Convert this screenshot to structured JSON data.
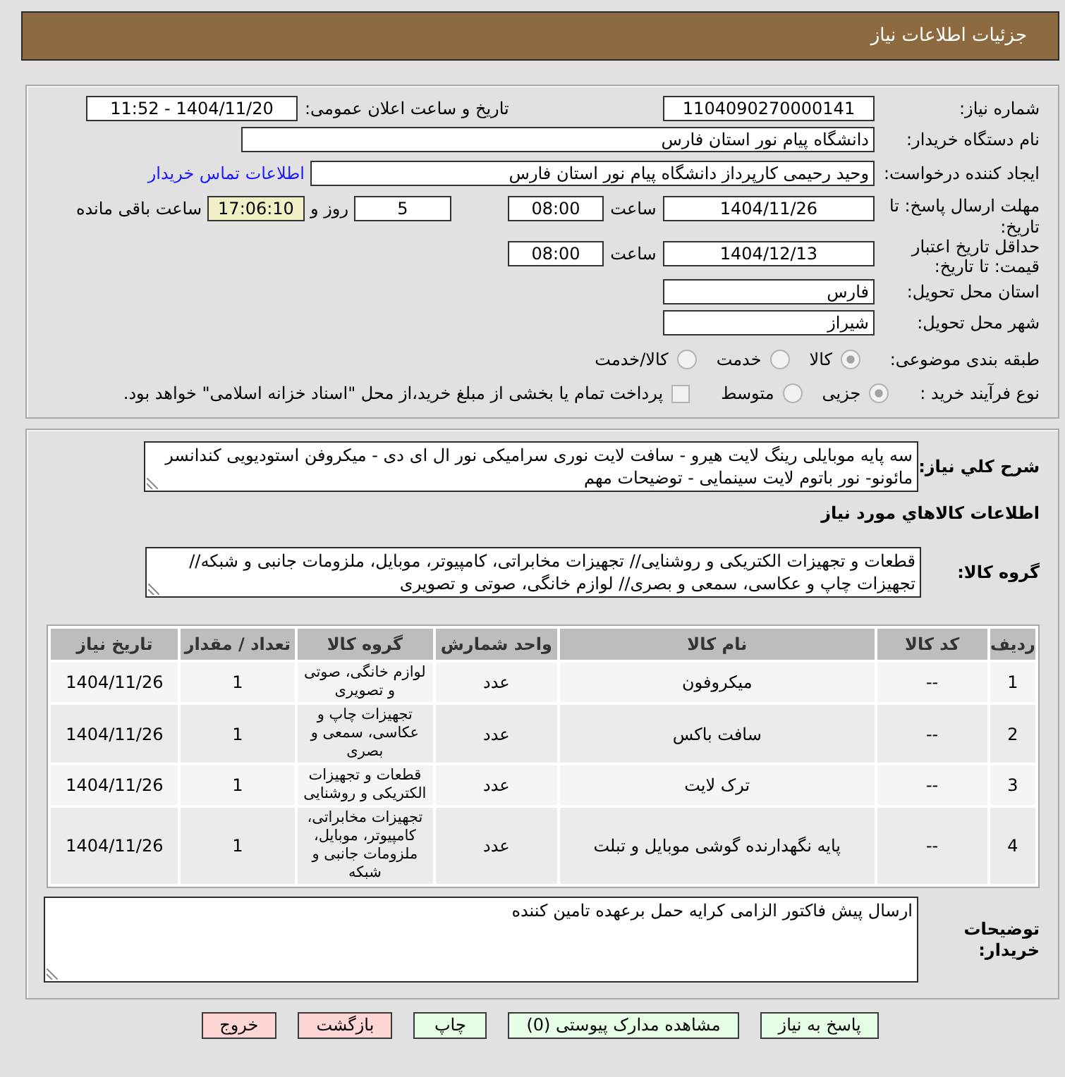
{
  "header": {
    "title": "جزئیات اطلاعات نیاز"
  },
  "need_number": {
    "label": "شماره نیاز:",
    "value": "1104090270000141"
  },
  "announcement": {
    "label": "تاریخ و ساعت اعلان عمومی:",
    "value": "1404/11/20 - 11:52"
  },
  "buyer_org": {
    "label": "نام دستگاه خریدار:",
    "value": "دانشگاه پیام نور استان فارس"
  },
  "requester": {
    "label": "ایجاد کننده درخواست:",
    "value": "وحید رحیمی کارپرداز دانشگاه پیام نور استان فارس",
    "contact_link": "اطلاعات تماس خریدار"
  },
  "reply_deadline": {
    "label": "مهلت ارسال پاسخ: تا تاریخ:",
    "date": "1404/11/26",
    "time_label": "ساعت",
    "time": "08:00",
    "days": "5",
    "days_label": "روز و",
    "remaining": "17:06:10",
    "remaining_label": "ساعت باقی مانده"
  },
  "price_validity": {
    "label": "حداقل تاریخ اعتبار قیمت: تا تاریخ:",
    "date": "1404/12/13",
    "time_label": "ساعت",
    "time": "08:00"
  },
  "delivery_province": {
    "label": "استان محل تحویل:",
    "value": "فارس"
  },
  "delivery_city": {
    "label": "شهر محل تحویل:",
    "value": "شیراز"
  },
  "category": {
    "label": "طبقه بندی موضوعی:",
    "options": [
      {
        "label": "کالا",
        "selected": true
      },
      {
        "label": "خدمت",
        "selected": false
      },
      {
        "label": "کالا/خدمت",
        "selected": false
      }
    ]
  },
  "process": {
    "label": "نوع فرآیند خرید :",
    "options": [
      {
        "label": "جزیی",
        "selected": true
      },
      {
        "label": "متوسط",
        "selected": false
      }
    ],
    "treasury": {
      "label": "پرداخت تمام یا بخشی از مبلغ خرید،از محل \"اسناد خزانه اسلامی\" خواهد بود.",
      "checked": false
    }
  },
  "description": {
    "label": "شرح کلي نیاز:",
    "value": "سه پایه موبایلی رینگ لایت هیرو - سافت لایت نوری سرامیکی نور ال ای دی - میکروفن استودیویی کندانسر مائونو- نور باتوم لایت سینمایی - توضیحات مهم"
  },
  "goods_title": "اطلاعات کالاهاي مورد نیاز",
  "goods_group": {
    "label": "گروه کالا:",
    "value": "قطعات و تجهیزات الکتریکی و روشنایی// تجهیزات مخابراتی، کامپیوتر، موبایل، ملزومات جانبی و شبکه// تجهیزات چاپ و عکاسی، سمعی و بصری// لوازم خانگی، صوتی و تصویری"
  },
  "table": {
    "columns": [
      "ردیف",
      "کد کالا",
      "نام کالا",
      "واحد شمارش",
      "گروه کالا",
      "تعداد / مقدار",
      "تاریخ نیاز"
    ],
    "rows": [
      {
        "cells": [
          "1",
          "--",
          "میکروفون",
          "عدد",
          "لوازم خانگی، صوتی و تصویری",
          "1",
          "1404/11/26"
        ]
      },
      {
        "cells": [
          "2",
          "--",
          "سافت باکس",
          "عدد",
          "تجهیزات چاپ و عکاسی، سمعی و بصری",
          "1",
          "1404/11/26"
        ]
      },
      {
        "cells": [
          "3",
          "--",
          "ترک لایت",
          "عدد",
          "قطعات و تجهیزات الکتریکی و روشنایی",
          "1",
          "1404/11/26"
        ]
      },
      {
        "cells": [
          "4",
          "--",
          "پایه نگهدارنده گوشی موبایل و تبلت",
          "عدد",
          "تجهیزات مخابراتی، کامپیوتر، موبایل، ملزومات جانبی و شبکه",
          "1",
          "1404/11/26"
        ]
      }
    ]
  },
  "buyer_notes": {
    "label": "توضیحات خریدار:",
    "value": "ارسال پیش فاکتور الزامی کرایه حمل برعهده تامین کننده"
  },
  "buttons": [
    {
      "label": "پاسخ به نیاز",
      "kind": "accept"
    },
    {
      "label": "مشاهده مدارک پیوستی (0)",
      "kind": "accept"
    },
    {
      "label": "چاپ",
      "kind": "accept"
    },
    {
      "label": "بازگشت",
      "kind": "cancel"
    },
    {
      "label": "خروج",
      "kind": "cancel"
    }
  ]
}
